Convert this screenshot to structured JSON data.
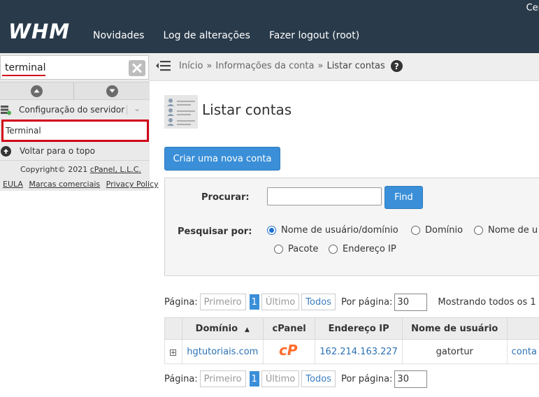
{
  "header": {
    "top_right_text": "Cer",
    "logo_text": "WHM",
    "nav": [
      "Novidades",
      "Log de alterações",
      "Fazer logout (root)"
    ]
  },
  "sidebar": {
    "search_value": "terminal",
    "category_label": "Configuração do servidor",
    "result_item": "Terminal",
    "back_to_top": "Voltar para o topo",
    "copyright_prefix": "Copyright© 2021 ",
    "copyright_link": "cPanel, L.L.C.",
    "footer_links": [
      "EULA",
      "Marcas comerciais",
      "Privacy Policy"
    ]
  },
  "breadcrumb": {
    "items": [
      "Início",
      "Informações da conta"
    ],
    "separator": "»",
    "current": "Listar contas",
    "help": "?"
  },
  "main": {
    "title": "Listar contas",
    "create_button": "Criar uma nova conta",
    "search": {
      "label": "Procurar:",
      "value": "",
      "find_button": "Find",
      "search_by_label": "Pesquisar por:",
      "options": [
        "Nome de usuário/domínio",
        "Domínio",
        "Nome de u",
        "Pacote",
        "Endereço IP"
      ],
      "selected": "Nome de usuário/domínio"
    },
    "pagination": {
      "label": "Página:",
      "first": "Primeiro",
      "page": "1",
      "last": "Último",
      "all": "Todos",
      "per_page_label": "Por página:",
      "per_page": "30",
      "showing": "Mostrando todos os 1"
    },
    "table": {
      "columns": [
        "Domínio",
        "cPanel",
        "Endereço IP",
        "Nome de usuário"
      ],
      "sort_indicator": "▲",
      "rows": [
        {
          "expand": "+",
          "domain": "hgtutoriais.com",
          "ip": "162.214.163.227",
          "user": "gatortur",
          "extra": "conta"
        }
      ]
    }
  },
  "colors": {
    "header_bg": "#293a4a",
    "primary": "#3a8fd8",
    "highlight": "#d0021b",
    "cpanel_orange": "#ff6c2c"
  }
}
